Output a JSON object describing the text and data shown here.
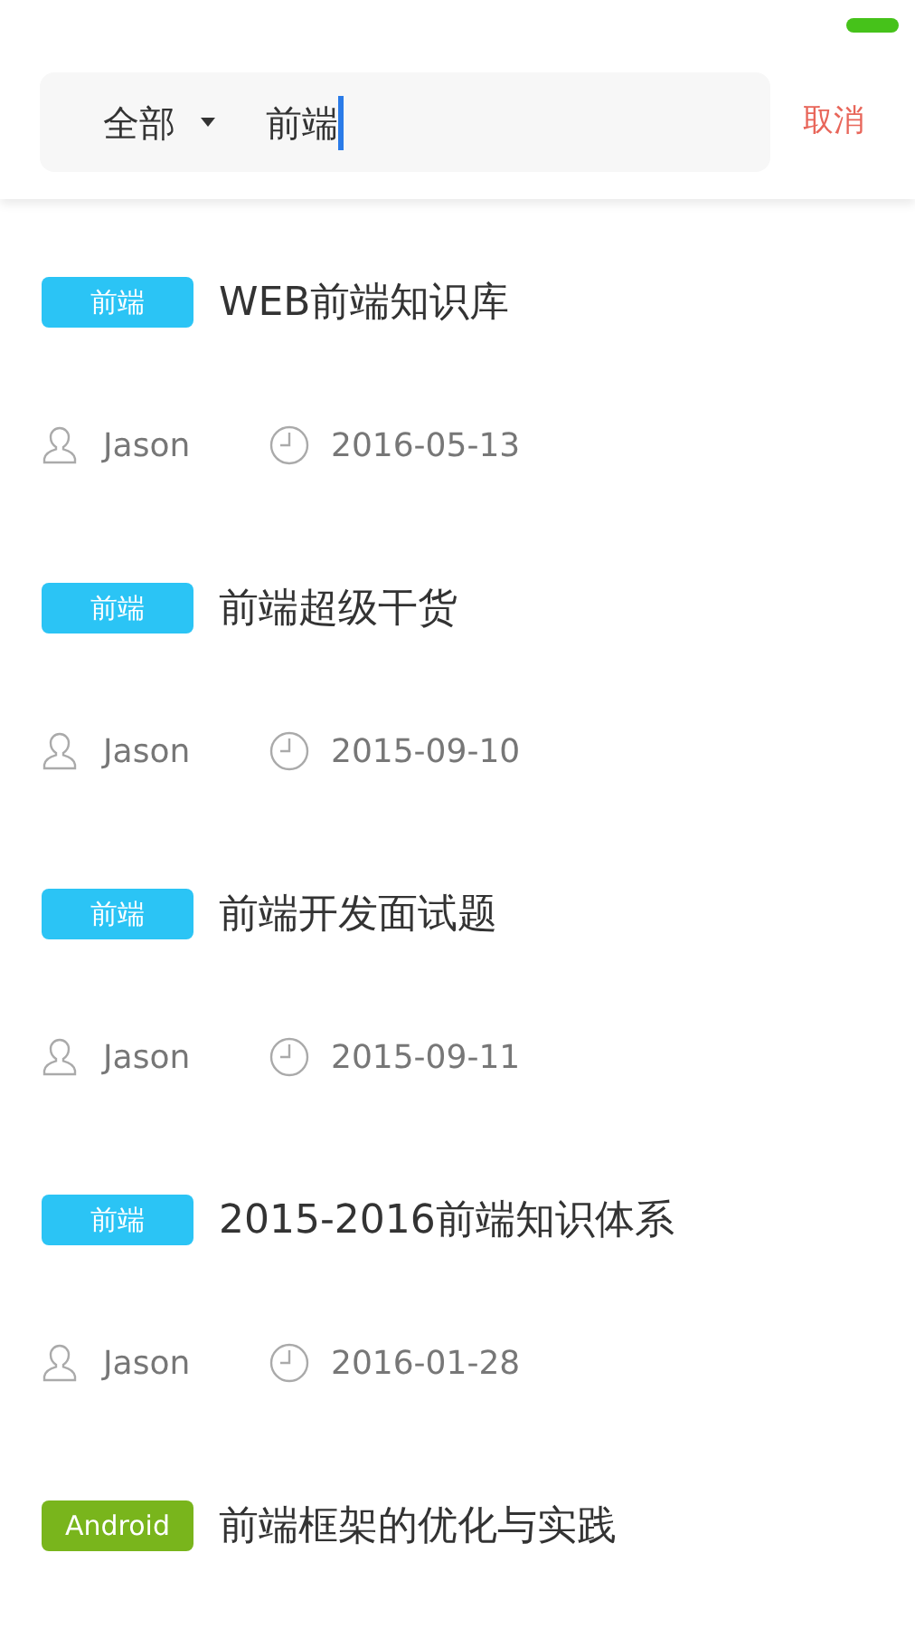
{
  "search": {
    "scope": "全部",
    "value": "前端",
    "cancel": "取消"
  },
  "articles": [
    {
      "tag": "前端",
      "color": "#2bc4f5",
      "title": "WEB前端知识库",
      "author": "Jason",
      "date": "2016-05-13"
    },
    {
      "tag": "前端",
      "color": "#2bc4f5",
      "title": "前端超级干货",
      "author": "Jason",
      "date": "2015-09-10"
    },
    {
      "tag": "前端",
      "color": "#2bc4f5",
      "title": "前端开发面试题",
      "author": "Jason",
      "date": "2015-09-11"
    },
    {
      "tag": "前端",
      "color": "#2bc4f5",
      "title": "2015-2016前端知识体系",
      "author": "Jason",
      "date": "2016-01-28"
    },
    {
      "tag": "Android",
      "color": "#79b51c",
      "title": "前端框架的优化与实践"
    }
  ]
}
